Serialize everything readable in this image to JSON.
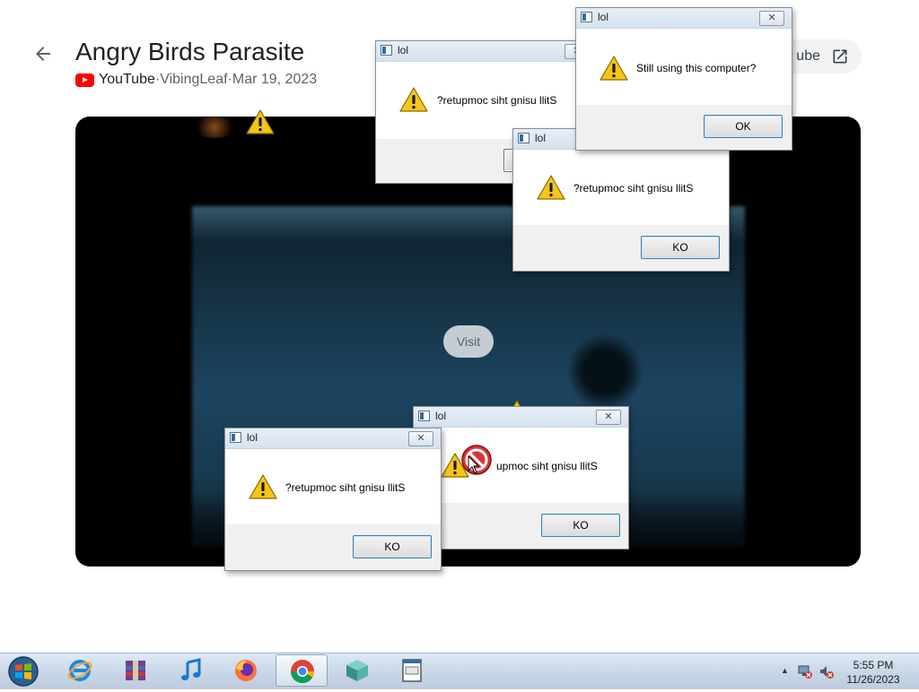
{
  "page": {
    "title": "Angry Birds Parasite",
    "source": "YouTube",
    "channel": "VibingLeaf",
    "date": "Mar 19, 2023",
    "separator": " · ",
    "open_label": "ube",
    "visit_label": "Visit"
  },
  "dialogs": [
    {
      "id": "dlg-1",
      "title": "lol",
      "message": "?retupmoc siht gnisu llitS",
      "button": "KO"
    },
    {
      "id": "dlg-2",
      "title": "lol",
      "message": "?retupmoc siht gnisu llitS",
      "button": "KO"
    },
    {
      "id": "dlg-3",
      "title": "lol",
      "message": "Still using this computer?",
      "button": "OK"
    },
    {
      "id": "dlg-4",
      "title": "lol",
      "message": "?retupmoc siht gnisu llitS",
      "button": "KO"
    },
    {
      "id": "dlg-5",
      "title": "lol",
      "message": "upmoc siht gnisu llitS",
      "button": "KO"
    }
  ],
  "taskbar": {
    "items": [
      {
        "name": "internet-explorer-icon"
      },
      {
        "name": "winrar-icon"
      },
      {
        "name": "itunes-icon"
      },
      {
        "name": "firefox-icon"
      },
      {
        "name": "chrome-icon",
        "active": true
      },
      {
        "name": "3d-cube-app-icon"
      },
      {
        "name": "program-window-icon"
      }
    ],
    "time": "5:55 PM",
    "date": "11/26/2023"
  },
  "colors": {
    "warning": "#f5c518",
    "youtube_red": "#ff0000",
    "taskbar": "#c9d8e8"
  }
}
